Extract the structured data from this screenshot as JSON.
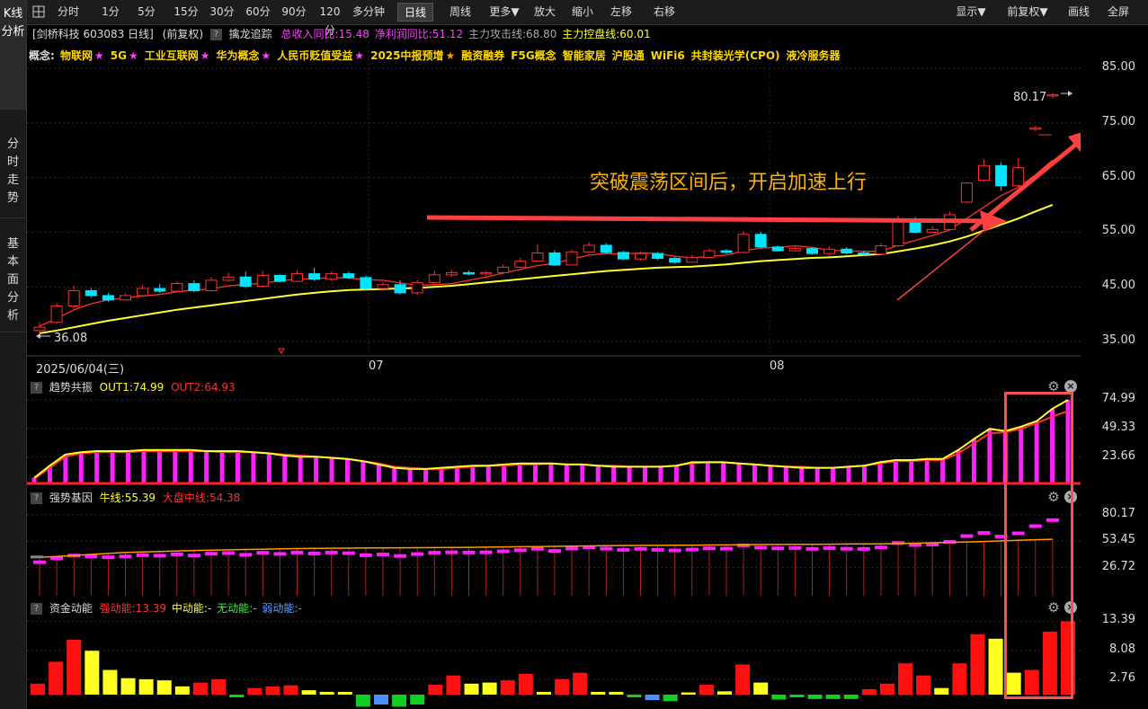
{
  "sidebar": {
    "tabs": [
      "K线分析",
      "分时走势",
      "基本面分析"
    ]
  },
  "toolbar": {
    "periods": [
      "分时",
      "1分",
      "5分",
      "15分",
      "30分",
      "60分",
      "90分",
      "120分",
      "多分钟",
      "日线",
      "周线",
      "更多▼",
      "放大",
      "缩小",
      "左移",
      "右移"
    ],
    "active": "日线",
    "right": [
      "显示▼",
      "前复权▼",
      "画线",
      "全屏"
    ]
  },
  "title": {
    "stock": "[剑桥科技 603083 日线]",
    "adjust": "(前复权)",
    "indicator": "擒龙追踪",
    "revenue": "总收入同比:15.48",
    "profit": "净利润同比:51.12",
    "attack": "主力攻击线:68.80",
    "control": "主力控盘线:60.01"
  },
  "concepts": {
    "prefix": "概念:",
    "items": [
      {
        "name": "物联网",
        "star": "★",
        "star_color": "magenta"
      },
      {
        "name": "5G",
        "star": "★",
        "star_color": "magenta"
      },
      {
        "name": "工业互联网",
        "star": "★",
        "star_color": "magenta"
      },
      {
        "name": "华为概念",
        "star": "★",
        "star_color": "magenta"
      },
      {
        "name": "人民币贬值受益",
        "star": "★",
        "star_color": "magenta"
      },
      {
        "name": "2025中报预增",
        "star": "★",
        "star_color": "orange"
      },
      {
        "name": "融资融券",
        "star": ""
      },
      {
        "name": "F5G概念",
        "star": ""
      },
      {
        "name": "智能家居",
        "star": ""
      },
      {
        "name": "沪股通",
        "star": ""
      },
      {
        "name": "WiFi6",
        "star": ""
      },
      {
        "name": "共封装光学(CPO)",
        "star": ""
      },
      {
        "name": "液冷服务器",
        "star": ""
      }
    ]
  },
  "main_chart": {
    "y_ticks": [
      "85.00",
      "75.00",
      "65.00",
      "55.00",
      "45.00",
      "35.00"
    ],
    "high_label": "80.17",
    "low_label": "36.08",
    "annotation": "突破震荡区间后，开启加速上行",
    "x_labels": [
      "2025/06/04(三)",
      "07",
      "08"
    ],
    "candles": [
      [
        37,
        37.6,
        36.1,
        38.5
      ],
      [
        38.5,
        41.5,
        38.2,
        42.0
      ],
      [
        41.5,
        44.3,
        41.0,
        45.2
      ],
      [
        44.3,
        43.4,
        43.0,
        44.8
      ],
      [
        43.4,
        42.6,
        42.2,
        43.9
      ],
      [
        42.6,
        43.4,
        42.5,
        43.8
      ],
      [
        43.4,
        44.7,
        43.2,
        45.3
      ],
      [
        44.7,
        44.2,
        43.9,
        45.5
      ],
      [
        44.2,
        45.6,
        44.0,
        46.0
      ],
      [
        45.6,
        44.3,
        44.0,
        46.2
      ],
      [
        44.3,
        46.2,
        44.1,
        46.8
      ],
      [
        46.2,
        46.8,
        45.9,
        47.6
      ],
      [
        46.8,
        45.1,
        44.8,
        47.8
      ],
      [
        45.1,
        47.1,
        44.9,
        47.9
      ],
      [
        47.1,
        46.0,
        45.8,
        47.3
      ],
      [
        46.0,
        47.4,
        45.9,
        48.0
      ],
      [
        47.4,
        46.4,
        46.1,
        48.5
      ],
      [
        46.4,
        47.4,
        46.1,
        47.8
      ],
      [
        47.4,
        46.7,
        46.4,
        47.8
      ],
      [
        46.7,
        44.7,
        44.4,
        47.1
      ],
      [
        44.7,
        45.4,
        44.3,
        45.8
      ],
      [
        45.4,
        43.9,
        43.6,
        46.2
      ],
      [
        43.9,
        45.8,
        43.5,
        46.3
      ],
      [
        45.8,
        47.2,
        45.6,
        47.9
      ],
      [
        47.2,
        47.6,
        46.8,
        48.1
      ],
      [
        47.6,
        47.4,
        47.1,
        48.0
      ],
      [
        47.4,
        47.6,
        47.0,
        47.9
      ],
      [
        47.6,
        48.6,
        47.4,
        49.1
      ],
      [
        48.6,
        49.7,
        48.4,
        50.3
      ],
      [
        49.7,
        51.2,
        49.5,
        52.8
      ],
      [
        51.2,
        49.0,
        48.8,
        51.7
      ],
      [
        49.0,
        51.4,
        48.9,
        51.8
      ],
      [
        51.4,
        52.6,
        51.2,
        53.2
      ],
      [
        52.6,
        51.3,
        51.0,
        53.0
      ],
      [
        51.3,
        50.1,
        49.9,
        51.6
      ],
      [
        50.1,
        51.1,
        49.8,
        51.5
      ],
      [
        51.1,
        50.2,
        49.9,
        51.4
      ],
      [
        50.2,
        49.5,
        49.2,
        50.5
      ],
      [
        49.5,
        50.4,
        49.4,
        50.8
      ],
      [
        50.4,
        51.6,
        50.3,
        52.0
      ],
      [
        51.6,
        51.3,
        51.0,
        51.9
      ],
      [
        51.3,
        54.6,
        51.1,
        55.2
      ],
      [
        54.6,
        52.3,
        52.0,
        55.0
      ],
      [
        52.3,
        51.6,
        51.4,
        52.6
      ],
      [
        51.6,
        52.0,
        51.4,
        52.4
      ],
      [
        52.0,
        51.1,
        50.9,
        52.3
      ],
      [
        51.1,
        51.9,
        50.9,
        52.4
      ],
      [
        51.9,
        51.2,
        50.9,
        52.3
      ],
      [
        51.2,
        51.0,
        50.8,
        51.6
      ],
      [
        51.0,
        52.5,
        50.9,
        53.0
      ],
      [
        52.5,
        57.0,
        52.3,
        58.0
      ],
      [
        57.0,
        55.0,
        54.8,
        57.8
      ],
      [
        55.0,
        55.5,
        54.9,
        56.1
      ],
      [
        55.5,
        58.2,
        55.3,
        58.8
      ],
      [
        60.5,
        64.0,
        60.3,
        64.2
      ],
      [
        64.5,
        67.2,
        64.2,
        68.3
      ],
      [
        67.2,
        63.5,
        62.6,
        67.8
      ],
      [
        63.5,
        66.8,
        63.3,
        68.6
      ],
      [
        74.0,
        74.1,
        73.5,
        74.5
      ],
      [
        80.0,
        80.17,
        79.5,
        80.5
      ]
    ],
    "ma5": [
      37.8,
      39.2,
      40.8,
      41.9,
      42.6,
      43.0,
      43.3,
      43.6,
      44.1,
      44.4,
      44.6,
      45.2,
      45.4,
      45.7,
      46.1,
      46.4,
      46.5,
      46.7,
      46.6,
      46.3,
      46.2,
      45.7,
      45.3,
      45.4,
      45.6,
      46.2,
      46.8,
      47.5,
      48.2,
      48.9,
      49.3,
      50.1,
      50.8,
      51.1,
      51.0,
      51.2,
      51.1,
      50.6,
      50.3,
      50.6,
      50.8,
      51.6,
      52.1,
      52.2,
      52.5,
      52.2,
      51.7,
      51.6,
      51.5,
      51.5,
      52.6,
      53.5,
      54.4,
      55.4,
      57.5,
      59.6,
      61.7,
      63.2,
      65.5,
      68.2
    ],
    "ma_yellow": [
      36.5,
      37.0,
      37.6,
      38.2,
      38.8,
      39.3,
      39.8,
      40.3,
      40.8,
      41.2,
      41.6,
      42.0,
      42.4,
      42.8,
      43.2,
      43.6,
      43.9,
      44.2,
      44.4,
      44.5,
      44.6,
      44.7,
      44.8,
      45.0,
      45.2,
      45.5,
      45.8,
      46.1,
      46.4,
      46.7,
      47.0,
      47.3,
      47.6,
      47.9,
      48.1,
      48.3,
      48.5,
      48.6,
      48.7,
      48.9,
      49.1,
      49.4,
      49.7,
      49.9,
      50.1,
      50.3,
      50.4,
      50.6,
      50.8,
      51.0,
      51.5,
      52.0,
      52.6,
      53.3,
      54.2,
      55.3,
      56.4,
      57.5,
      58.8,
      60.01
    ]
  },
  "trend_panel": {
    "name": "趋势共振",
    "out1": "OUT1:74.99",
    "out2": "OUT2:64.93",
    "y_ticks": [
      "74.99",
      "49.33",
      "23.66"
    ],
    "bars": [
      5,
      16,
      26,
      28,
      29,
      29,
      29,
      30,
      30,
      30,
      30,
      29,
      29,
      29,
      28,
      27,
      25,
      24,
      24,
      23,
      22,
      20,
      17,
      14,
      13,
      13,
      14,
      15,
      16,
      16,
      17,
      18,
      18,
      18,
      17,
      17,
      16,
      15,
      15,
      15,
      15,
      16,
      19,
      19,
      19,
      18,
      17,
      16,
      15,
      14,
      14,
      14,
      15,
      16,
      19,
      21,
      21,
      22,
      22,
      30,
      40,
      49,
      47,
      51,
      56,
      67,
      74.99
    ],
    "out2_line": [
      4,
      14,
      24,
      27,
      28,
      28,
      28,
      29,
      29,
      29,
      29,
      29,
      28,
      28,
      28,
      27,
      26,
      25,
      24,
      23,
      22,
      20,
      18,
      15,
      14,
      13,
      13,
      14,
      15,
      16,
      16,
      17,
      17,
      18,
      17,
      17,
      16,
      16,
      15,
      15,
      15,
      16,
      18,
      19,
      19,
      18,
      17,
      16,
      15,
      15,
      14,
      14,
      15,
      16,
      18,
      20,
      20,
      21,
      21,
      27,
      36,
      45,
      46,
      49,
      54,
      60,
      64.93
    ]
  },
  "strong_panel": {
    "name": "强势基因",
    "bull": "牛线:55.39",
    "market": "大盘中线:54.38",
    "y_ticks": [
      "80.17",
      "53.45",
      "26.72"
    ],
    "bull_line": [
      37,
      38,
      39,
      40,
      41,
      42,
      42.5,
      43,
      43.5,
      44,
      44.3,
      44.6,
      45,
      45.3,
      45.6,
      45.9,
      46.1,
      46.3,
      46.4,
      46.5,
      46.6,
      46.7,
      46.8,
      46.9,
      47,
      47.2,
      47.4,
      47.6,
      47.8,
      48,
      48.2,
      48.4,
      48.6,
      48.8,
      49,
      49.1,
      49.2,
      49.3,
      49.4,
      49.5,
      49.6,
      49.8,
      50,
      50.1,
      50.2,
      50.3,
      50.4,
      50.5,
      50.6,
      50.7,
      51,
      51.4,
      51.8,
      52.2,
      52.6,
      53.1,
      53.7,
      54.3,
      54.9,
      55.39
    ]
  },
  "fund_panel": {
    "name": "资金动能",
    "strong": "强动能:13.39",
    "mid": "中动能:-",
    "none": "无动能:-",
    "weak": "弱动能:-",
    "y_ticks": [
      "13.39",
      "8.08",
      "2.76"
    ],
    "bars": [
      [
        2,
        "r"
      ],
      [
        6,
        "r"
      ],
      [
        10,
        "r"
      ],
      [
        8,
        "y"
      ],
      [
        4.5,
        "y"
      ],
      [
        3,
        "y"
      ],
      [
        2.8,
        "y"
      ],
      [
        2.6,
        "y"
      ],
      [
        1.5,
        "y"
      ],
      [
        2.2,
        "r"
      ],
      [
        2.8,
        "r"
      ],
      [
        -0.5,
        "g"
      ],
      [
        1.2,
        "r"
      ],
      [
        1.5,
        "r"
      ],
      [
        1.7,
        "r"
      ],
      [
        0.8,
        "y"
      ],
      [
        0.5,
        "y"
      ],
      [
        0.5,
        "y"
      ],
      [
        -2.2,
        "g"
      ],
      [
        -1.8,
        "b"
      ],
      [
        -2.2,
        "g"
      ],
      [
        -1.8,
        "g"
      ],
      [
        1.8,
        "r"
      ],
      [
        3.5,
        "r"
      ],
      [
        2.0,
        "y"
      ],
      [
        2.2,
        "y"
      ],
      [
        2.6,
        "r"
      ],
      [
        3.8,
        "r"
      ],
      [
        0.5,
        "y"
      ],
      [
        2.8,
        "r"
      ],
      [
        4.0,
        "r"
      ],
      [
        0.5,
        "y"
      ],
      [
        0.5,
        "y"
      ],
      [
        -0.5,
        "g"
      ],
      [
        -1.0,
        "b"
      ],
      [
        -1.2,
        "g"
      ],
      [
        0.4,
        "y"
      ],
      [
        1.8,
        "r"
      ],
      [
        0.6,
        "y"
      ],
      [
        5.5,
        "r"
      ],
      [
        2.2,
        "y"
      ],
      [
        -0.9,
        "g"
      ],
      [
        -0.5,
        "g"
      ],
      [
        -0.8,
        "g"
      ],
      [
        -0.8,
        "g"
      ],
      [
        -0.8,
        "g"
      ],
      [
        1.0,
        "r"
      ],
      [
        2.0,
        "r"
      ],
      [
        5.7,
        "r"
      ],
      [
        3.5,
        "r"
      ],
      [
        1.2,
        "y"
      ],
      [
        5.7,
        "r"
      ],
      [
        11.0,
        "r"
      ],
      [
        10.2,
        "y"
      ],
      [
        4.0,
        "y"
      ],
      [
        4.5,
        "r"
      ],
      [
        11.5,
        "r"
      ],
      [
        13.39,
        "r"
      ]
    ]
  },
  "colors": {
    "up": "#ff3030",
    "down": "#00e5ff",
    "ma5": "#ff3030",
    "ma_yellow": "#ffff30",
    "highlight": "#ff5050",
    "arrow": "#ff4040",
    "annotation": "#ffb000"
  }
}
